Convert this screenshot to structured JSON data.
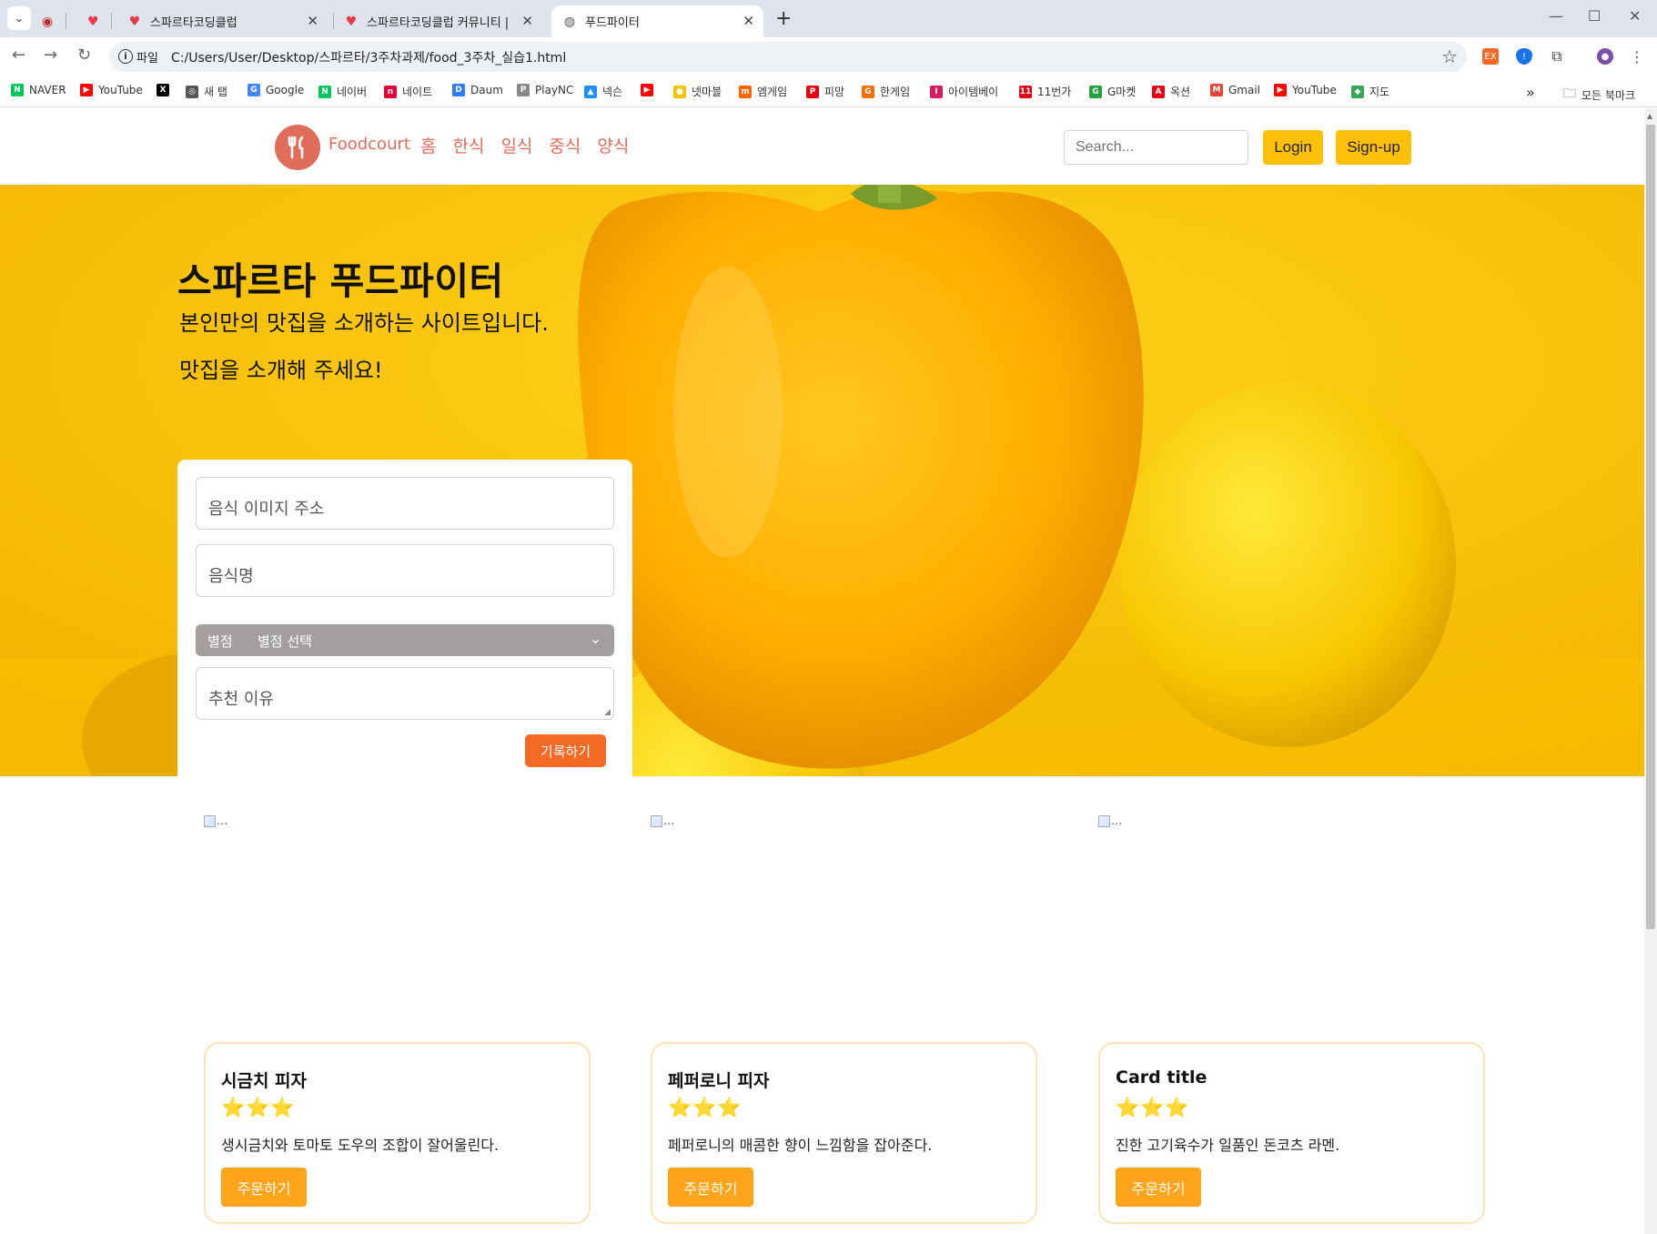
{
  "browser": {
    "tabs": [
      {
        "title": "",
        "icon": "record-icon"
      },
      {
        "title": "",
        "icon": "heart-icon"
      },
      {
        "title": "스파르타코딩클럽",
        "icon": "heart-icon"
      },
      {
        "title": "스파르타코딩클럽 커뮤니티 | ",
        "icon": "heart-icon"
      },
      {
        "title": "푸드파이터",
        "icon": "globe-icon"
      }
    ],
    "address": {
      "scheme_label": "파일",
      "url": "C:/Users/User/Desktop/스파르타/3주차과제/food_3주차_실습1.html"
    },
    "bookmarks": [
      {
        "label": "NAVER",
        "color": "#03c75a",
        "glyph": "N"
      },
      {
        "label": "YouTube",
        "color": "#ff0000",
        "glyph": "▶"
      },
      {
        "label": "",
        "color": "#000000",
        "glyph": "X"
      },
      {
        "label": "새 탭",
        "color": "#555555",
        "glyph": "◎"
      },
      {
        "label": "Google",
        "color": "#4285f4",
        "glyph": "G"
      },
      {
        "label": "네이버",
        "color": "#03c75a",
        "glyph": "N"
      },
      {
        "label": "네이트",
        "color": "#e4003a",
        "glyph": "n"
      },
      {
        "label": "Daum",
        "color": "#2e7cf6",
        "glyph": "D"
      },
      {
        "label": "PlayNC",
        "color": "#888888",
        "glyph": "P"
      },
      {
        "label": "넥슨",
        "color": "#1e90ff",
        "glyph": "▲"
      },
      {
        "label": "",
        "color": "#ff0000",
        "glyph": "▶"
      },
      {
        "label": "넷마블",
        "color": "#f5c400",
        "glyph": "●"
      },
      {
        "label": "엠게임",
        "color": "#ff6600",
        "glyph": "m"
      },
      {
        "label": "피망",
        "color": "#e60012",
        "glyph": "P"
      },
      {
        "label": "한게임",
        "color": "#ff6d00",
        "glyph": "G"
      },
      {
        "label": "아이템베이",
        "color": "#d81b60",
        "glyph": "I"
      },
      {
        "label": "11번가",
        "color": "#e60012",
        "glyph": "11"
      },
      {
        "label": "G마켓",
        "color": "#22a33a",
        "glyph": "G"
      },
      {
        "label": "옥션",
        "color": "#e60012",
        "glyph": "A"
      },
      {
        "label": "Gmail",
        "color": "#ea4335",
        "glyph": "M"
      },
      {
        "label": "YouTube",
        "color": "#ff0000",
        "glyph": "▶"
      },
      {
        "label": "지도",
        "color": "#34a853",
        "glyph": "◆"
      }
    ],
    "bookmarks_more": "»",
    "all_bookmarks": "모든 북마크"
  },
  "site": {
    "brand": "Foodcourt",
    "nav": [
      "홈",
      "한식",
      "일식",
      "중식",
      "양식"
    ],
    "search_placeholder": "Search...",
    "login": "Login",
    "signup": "Sign-up"
  },
  "hero": {
    "title": "스파르타 푸드파이터",
    "subtitle1": "본인만의 맛집을 소개하는 사이트입니다.",
    "subtitle2": "맛집을 소개해 주세요!"
  },
  "form": {
    "image_placeholder": "음식 이미지 주소",
    "name_placeholder": "음식명",
    "rating_label": "별점",
    "rating_value": "별점 선택",
    "reason_placeholder": "추천 이유",
    "submit": "기록하기"
  },
  "cards": [
    {
      "img_alt": "...",
      "title": "시금치 피자",
      "stars": "⭐⭐⭐",
      "text": "생시금치와 토마토 도우의 조합이 잘어울린다.",
      "button": "주문하기"
    },
    {
      "img_alt": "...",
      "title": "페퍼로니 피자",
      "stars": "⭐⭐⭐",
      "text": "페퍼로니의 매콤한 향이 느낌함을 잡아준다.",
      "button": "주문하기"
    },
    {
      "img_alt": "...",
      "title": "Card title",
      "stars": "⭐⭐⭐",
      "text": "진한 고기육수가 일품인 돈코츠 라멘.",
      "button": "주문하기"
    }
  ],
  "colors": {
    "brand": "#e06c5a",
    "accent_yellow": "#ffc107",
    "submit_orange": "#f26a24",
    "order_orange": "#ffa41b"
  }
}
